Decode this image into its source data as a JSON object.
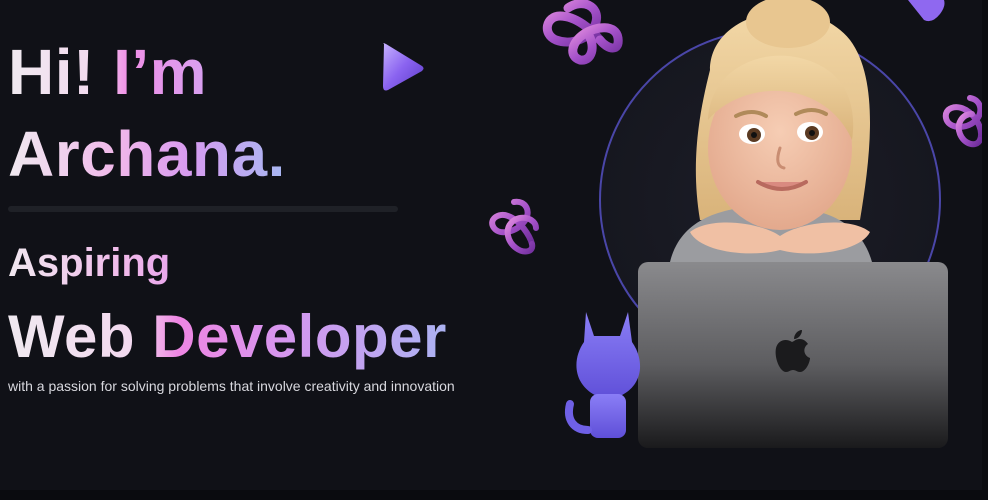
{
  "hero": {
    "greeting_line1": "Hi! I’m",
    "greeting_line2": "Archana.",
    "role_prefix": "Aspiring",
    "role_title": "Web Developer",
    "tagline": "with a passion for solving problems that involve creativity and innovation"
  },
  "decorations": {
    "shapes": [
      "triangle-cone-icon",
      "trefoil-knot-icon",
      "trefoil-knot-icon",
      "trefoil-knot-icon",
      "triangle-cone-icon"
    ],
    "mascot": "github-octocat-icon",
    "laptop_logo": "apple-logo-icon"
  },
  "colors": {
    "background": "#101117",
    "accent_pink": "#ee86e3",
    "accent_purple": "#b276e8",
    "accent_blue": "#a3b8f3",
    "octocat": "#7c6df2",
    "circle_ring": "#4a46a8"
  }
}
